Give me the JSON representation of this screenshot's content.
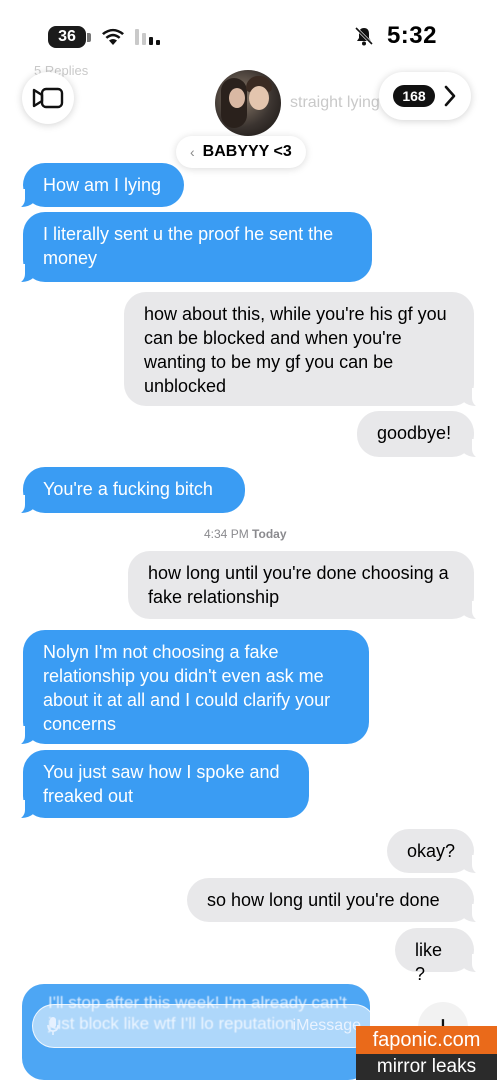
{
  "status_bar": {
    "battery": "36",
    "time": "5:32"
  },
  "header": {
    "back_count": "168",
    "contact_name": "BABYYY <3",
    "ghost_replies": "5 Replies",
    "ghost_straight": "straight lying"
  },
  "messages": [
    {
      "side": "received",
      "text": "How am I lying"
    },
    {
      "side": "received",
      "text": "I literally sent u the proof he sent the money"
    },
    {
      "side": "sent",
      "text": "how about this, while you're his gf you can be blocked and when you're wanting to be my gf you can be unblocked"
    },
    {
      "side": "sent",
      "text": "goodbye!"
    },
    {
      "side": "received",
      "text": "You're a fucking bitch"
    },
    {
      "side": "sent",
      "text": "how long until you're done choosing a fake relationship"
    },
    {
      "side": "received",
      "text": "Nolyn I'm not choosing a fake relationship you didn't even ask me about it at all and I could clarify your concerns"
    },
    {
      "side": "received",
      "text": "You just saw how I spoke and freaked out"
    },
    {
      "side": "sent",
      "text": "okay?"
    },
    {
      "side": "sent",
      "text": "so how long until you're done"
    },
    {
      "side": "sent",
      "text": "like ?"
    }
  ],
  "timestamp": {
    "day": "Today",
    "time": "4:34 PM"
  },
  "input": {
    "placeholder": "iMessage",
    "partial_text": "I'll stop after this week! I'm already can't just block like wtf I'll lo reputation"
  },
  "watermark": {
    "line1": "faponic.com",
    "line2": "mirror leaks"
  },
  "colors": {
    "blue_bubble": "#3a9cf3",
    "gray_bubble": "#e8e8ea"
  }
}
